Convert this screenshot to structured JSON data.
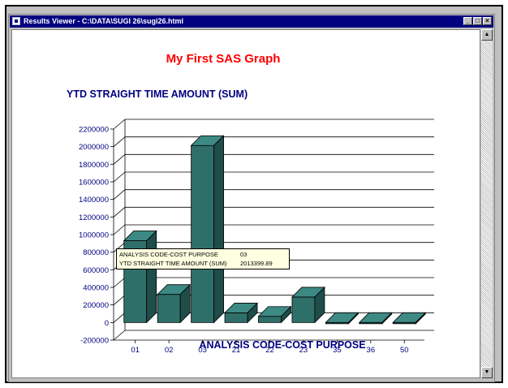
{
  "window": {
    "title": "Results Viewer - C:\\DATA\\SUGI 26\\sugi26.html",
    "minimize_glyph": "_",
    "maximize_glyph": "□",
    "close_glyph": "×"
  },
  "scrollbar": {
    "up_glyph": "▲",
    "down_glyph": "▼"
  },
  "tooltip": {
    "label1": "ANALYSIS CODE-COST PURPOSE",
    "value1": "03",
    "label2": "YTD STRAIGHT TIME AMOUNT (SUM)",
    "value2": "2013399.89"
  },
  "colors": {
    "bar": "#2f6f6a",
    "bar_top": "#3d8a84",
    "bar_side": "#1f4d49",
    "title": "#ff0000",
    "axis_text": "#000080"
  },
  "chart_data": {
    "type": "bar",
    "title": "My First SAS Graph",
    "ylabel": "YTD STRAIGHT TIME AMOUNT (SUM)",
    "xlabel": "ANALYSIS CODE-COST PURPOSE",
    "categories": [
      "01",
      "02",
      "03",
      "21",
      "22",
      "23",
      "35",
      "36",
      "50"
    ],
    "values": [
      930000,
      320000,
      2013399.89,
      110000,
      70000,
      290000,
      0,
      -10000,
      0
    ],
    "yticks": [
      2200000,
      2000000,
      1800000,
      1600000,
      1400000,
      1200000,
      1000000,
      800000,
      600000,
      400000,
      200000,
      0,
      -200000
    ],
    "ylim": [
      -200000,
      2200000
    ],
    "grid": true,
    "style": "3d"
  }
}
